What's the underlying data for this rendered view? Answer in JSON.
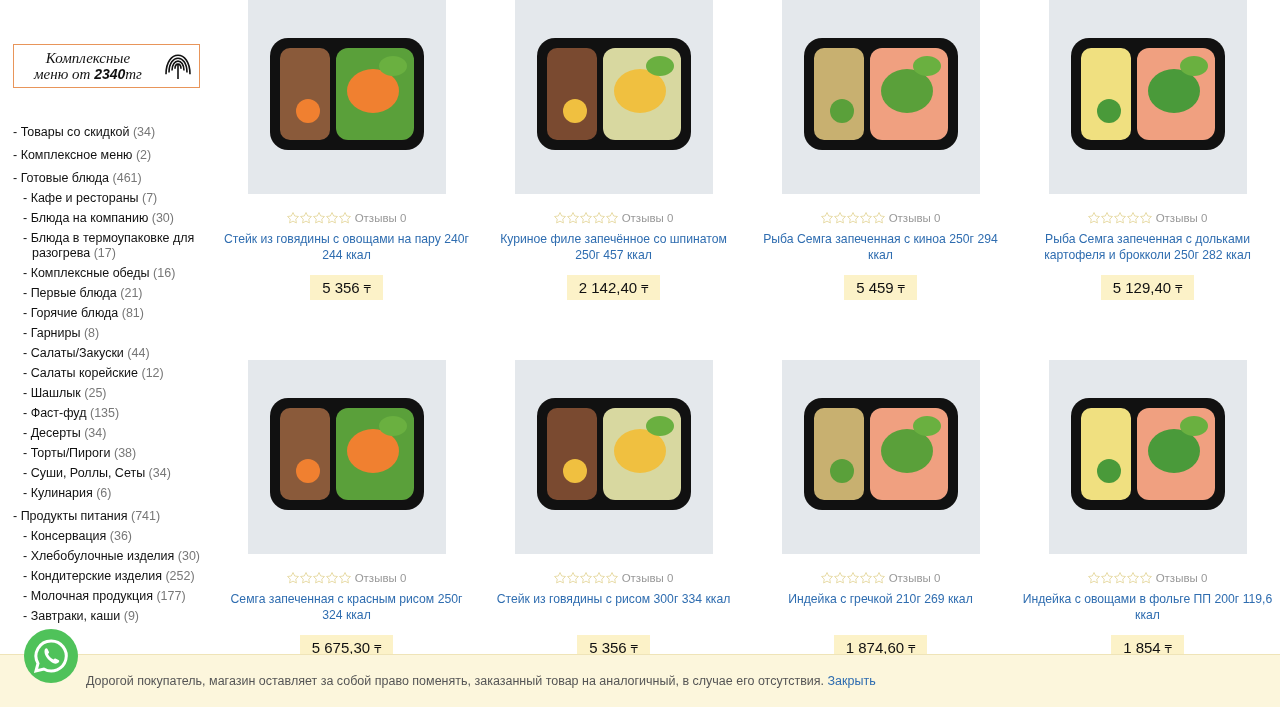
{
  "banner": {
    "line1": "Комплексные",
    "line2": "меню от **2340**тг"
  },
  "sidebar": {
    "items": [
      {
        "label": "- Товары со скидкой",
        "count": "(34)"
      },
      {
        "label": "- Комплексное меню",
        "count": "(2)"
      },
      {
        "label": "- Готовые блюда",
        "count": "(461)",
        "children": [
          {
            "label": "- Кафе и рестораны",
            "count": "(7)"
          },
          {
            "label": "- Блюда на компанию",
            "count": "(30)"
          },
          {
            "label": "- Блюда в термоупаковке для разогрева",
            "count": "(17)"
          },
          {
            "label": "- Комплексные обеды",
            "count": "(16)"
          },
          {
            "label": "- Первые блюда",
            "count": "(21)"
          },
          {
            "label": "- Горячие блюда",
            "count": "(81)"
          },
          {
            "label": "- Гарниры",
            "count": "(8)"
          },
          {
            "label": "- Салаты/Закуски",
            "count": "(44)"
          },
          {
            "label": "- Салаты корейские",
            "count": "(12)"
          },
          {
            "label": "- Шашлык",
            "count": "(25)"
          },
          {
            "label": "- Фаст-фуд",
            "count": "(135)"
          },
          {
            "label": "- Десерты",
            "count": "(34)"
          },
          {
            "label": "- Торты/Пироги",
            "count": "(38)"
          },
          {
            "label": "- Суши, Роллы, Сеты",
            "count": "(34)"
          },
          {
            "label": "- Кулинария",
            "count": "(6)"
          }
        ]
      },
      {
        "label": "- Продукты питания",
        "count": "(741)",
        "children": [
          {
            "label": "- Консервация",
            "count": "(36)"
          },
          {
            "label": "- Хлебобулочные изделия",
            "count": "(30)"
          },
          {
            "label": "- Кондитерские изделия",
            "count": "(252)"
          },
          {
            "label": "- Молочная продукция",
            "count": "(177)"
          },
          {
            "label": "- Завтраки, каши",
            "count": "(9)"
          }
        ]
      }
    ]
  },
  "products": [
    {
      "title": "Стейк из говядины с овощами на пару 240г 244 ккал",
      "stars": 0,
      "reviews": "Отзывы 0",
      "price": "5 356",
      "currency": "₸"
    },
    {
      "title": "Куриное филе запечённое со шпинатом 250г 457 ккал",
      "stars": 0,
      "reviews": "Отзывы 0",
      "price": "2 142,40",
      "currency": "₸"
    },
    {
      "title": "Рыба Семга запеченная с киноа 250г 294 ккал",
      "stars": 0,
      "reviews": "Отзывы 0",
      "price": "5 459",
      "currency": "₸"
    },
    {
      "title": "Рыба Семга запеченная с дольками картофеля и брокколи 250г 282 ккал",
      "stars": 0,
      "reviews": "Отзывы 0",
      "price": "5 129,40",
      "currency": "₸"
    },
    {
      "title": "Семга запеченная с красным рисом 250г 324 ккал",
      "stars": 0,
      "reviews": "Отзывы 0",
      "price": "5 675,30",
      "currency": "₸"
    },
    {
      "title": "Стейк из говядины с рисом 300г 334 ккал",
      "stars": 0,
      "reviews": "Отзывы 0",
      "price": "5 356",
      "currency": "₸"
    },
    {
      "title": "Индейка с гречкой 210г 269 ккал",
      "stars": 0,
      "reviews": "Отзывы 0",
      "price": "1 874,60",
      "currency": "₸"
    },
    {
      "title": "Индейка с овощами в фольге ПП 200г 119,6 ккал",
      "stars": 0,
      "reviews": "Отзывы 0",
      "price": "1 854",
      "currency": "₸"
    }
  ],
  "notice": {
    "text": "Дорогой покупатель, магазин оставляет за собой право поменять, заказанный товар на аналогичный, в случае его отсутствия.",
    "link": "Закрыть"
  }
}
